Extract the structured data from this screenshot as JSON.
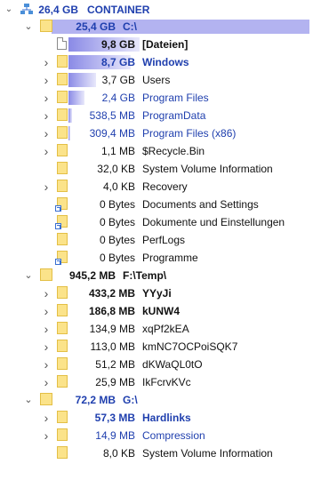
{
  "root": {
    "size": "26,4 GB",
    "name": "CONTAINER"
  },
  "colors": {
    "bar": "#b3b3f0",
    "barDark": "#8a8ae6",
    "folder": "#fbe38a",
    "blueText": "#1f3fae"
  },
  "rows": [
    {
      "size": "25,4 GB",
      "name": "C:\\",
      "level": 1,
      "toggle": "expanded",
      "icon": "folder",
      "bold": true,
      "blue": true,
      "bar": 1.0
    },
    {
      "size": "9,8 GB",
      "name": "[Dateien]",
      "level": 2,
      "toggle": "none",
      "icon": "file",
      "bold": true,
      "blue": false,
      "bar": 0.39
    },
    {
      "size": "8,7 GB",
      "name": "Windows",
      "level": 2,
      "toggle": "collapsed",
      "icon": "folder",
      "bold": true,
      "blue": true,
      "bar": 0.34
    },
    {
      "size": "3,7 GB",
      "name": "Users",
      "level": 2,
      "toggle": "collapsed",
      "icon": "folder",
      "bold": false,
      "blue": false,
      "bar": 0.15
    },
    {
      "size": "2,4 GB",
      "name": "Program Files",
      "level": 2,
      "toggle": "collapsed",
      "icon": "folder",
      "bold": false,
      "blue": true,
      "bar": 0.09
    },
    {
      "size": "538,5 MB",
      "name": "ProgramData",
      "level": 2,
      "toggle": "collapsed",
      "icon": "folder",
      "bold": false,
      "blue": true,
      "bar": 0.02
    },
    {
      "size": "309,4 MB",
      "name": "Program Files (x86)",
      "level": 2,
      "toggle": "collapsed",
      "icon": "folder",
      "bold": false,
      "blue": true,
      "bar": 0.01
    },
    {
      "size": "1,1 MB",
      "name": "$Recycle.Bin",
      "level": 2,
      "toggle": "collapsed",
      "icon": "folder",
      "bold": false,
      "blue": false,
      "bar": 0
    },
    {
      "size": "32,0 KB",
      "name": "System Volume Information",
      "level": 2,
      "toggle": "none",
      "icon": "folder",
      "bold": false,
      "blue": false,
      "bar": 0
    },
    {
      "size": "4,0 KB",
      "name": "Recovery",
      "level": 2,
      "toggle": "collapsed",
      "icon": "folder",
      "bold": false,
      "blue": false,
      "bar": 0
    },
    {
      "size": "0 Bytes",
      "name": "Documents and Settings",
      "level": 2,
      "toggle": "none",
      "icon": "link",
      "bold": false,
      "blue": false,
      "bar": 0
    },
    {
      "size": "0 Bytes",
      "name": "Dokumente und Einstellungen",
      "level": 2,
      "toggle": "none",
      "icon": "link",
      "bold": false,
      "blue": false,
      "bar": 0
    },
    {
      "size": "0 Bytes",
      "name": "PerfLogs",
      "level": 2,
      "toggle": "none",
      "icon": "folder",
      "bold": false,
      "blue": false,
      "bar": 0
    },
    {
      "size": "0 Bytes",
      "name": "Programme",
      "level": 2,
      "toggle": "none",
      "icon": "link",
      "bold": false,
      "blue": false,
      "bar": 0
    },
    {
      "size": "945,2 MB",
      "name": "F:\\Temp\\",
      "level": 1,
      "toggle": "expanded",
      "icon": "folder",
      "bold": true,
      "blue": false,
      "bar": 0
    },
    {
      "size": "433,2 MB",
      "name": "YYyJi",
      "level": 2,
      "toggle": "collapsed",
      "icon": "folder",
      "bold": true,
      "blue": false,
      "bar": 0
    },
    {
      "size": "186,8 MB",
      "name": "kUNW4",
      "level": 2,
      "toggle": "collapsed",
      "icon": "folder",
      "bold": true,
      "blue": false,
      "bar": 0
    },
    {
      "size": "134,9 MB",
      "name": "xqPf2kEA",
      "level": 2,
      "toggle": "collapsed",
      "icon": "folder",
      "bold": false,
      "blue": false,
      "bar": 0
    },
    {
      "size": "113,0 MB",
      "name": "kmNC7OCPoiSQK7",
      "level": 2,
      "toggle": "collapsed",
      "icon": "folder",
      "bold": false,
      "blue": false,
      "bar": 0
    },
    {
      "size": "51,2 MB",
      "name": "dKWaQL0tO",
      "level": 2,
      "toggle": "collapsed",
      "icon": "folder",
      "bold": false,
      "blue": false,
      "bar": 0
    },
    {
      "size": "25,9 MB",
      "name": "IkFcrvKVc",
      "level": 2,
      "toggle": "collapsed",
      "icon": "folder",
      "bold": false,
      "blue": false,
      "bar": 0
    },
    {
      "size": "72,2 MB",
      "name": "G:\\",
      "level": 1,
      "toggle": "expanded",
      "icon": "folder",
      "bold": true,
      "blue": true,
      "bar": 0
    },
    {
      "size": "57,3 MB",
      "name": "Hardlinks",
      "level": 2,
      "toggle": "collapsed",
      "icon": "folder",
      "bold": true,
      "blue": true,
      "bar": 0
    },
    {
      "size": "14,9 MB",
      "name": "Compression",
      "level": 2,
      "toggle": "collapsed",
      "icon": "folder",
      "bold": false,
      "blue": true,
      "bar": 0
    },
    {
      "size": "8,0 KB",
      "name": "System Volume Information",
      "level": 2,
      "toggle": "none",
      "icon": "folder",
      "bold": false,
      "blue": false,
      "bar": 0
    }
  ]
}
